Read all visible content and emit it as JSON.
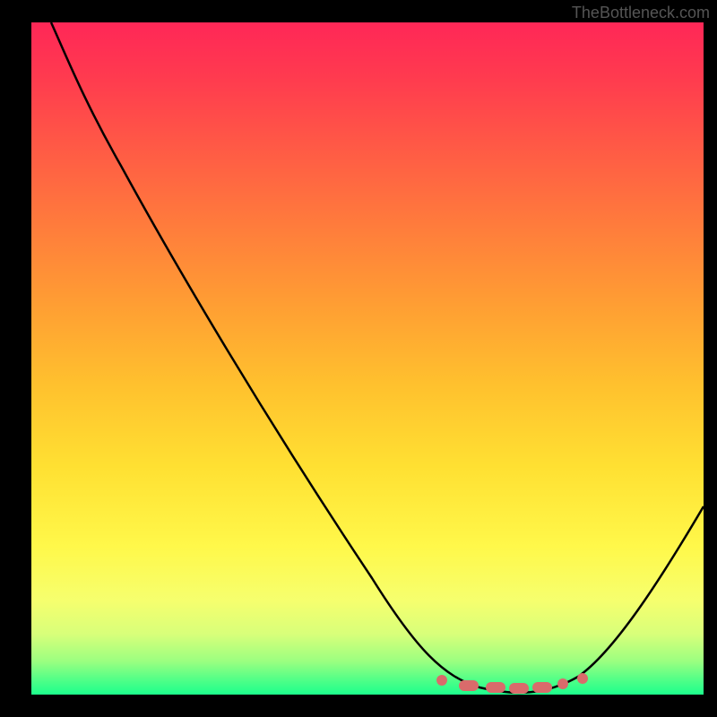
{
  "watermark": "TheBottleneck.com",
  "chart_data": {
    "type": "line",
    "title": "",
    "xlabel": "",
    "ylabel": "",
    "xlim": [
      0,
      100
    ],
    "ylim": [
      0,
      100
    ],
    "series": [
      {
        "name": "curve",
        "x": [
          3,
          8,
          15,
          25,
          40,
          55,
          62,
          66,
          70,
          74,
          78,
          82,
          86,
          92,
          100
        ],
        "y": [
          100,
          92,
          80,
          63,
          38,
          13,
          4,
          1.5,
          0.7,
          0.5,
          0.7,
          1.8,
          6,
          18,
          40
        ]
      }
    ],
    "markers": {
      "x": [
        61,
        65,
        69,
        72,
        75,
        78,
        82
      ],
      "y": [
        2.0,
        1.2,
        0.9,
        0.8,
        0.9,
        1.4,
        2.2
      ]
    },
    "gradient_stops": [
      {
        "pos": 0.0,
        "color": "#ff2757"
      },
      {
        "pos": 0.5,
        "color": "#ffb030"
      },
      {
        "pos": 0.8,
        "color": "#fff84a"
      },
      {
        "pos": 1.0,
        "color": "#1cff8c"
      }
    ]
  }
}
